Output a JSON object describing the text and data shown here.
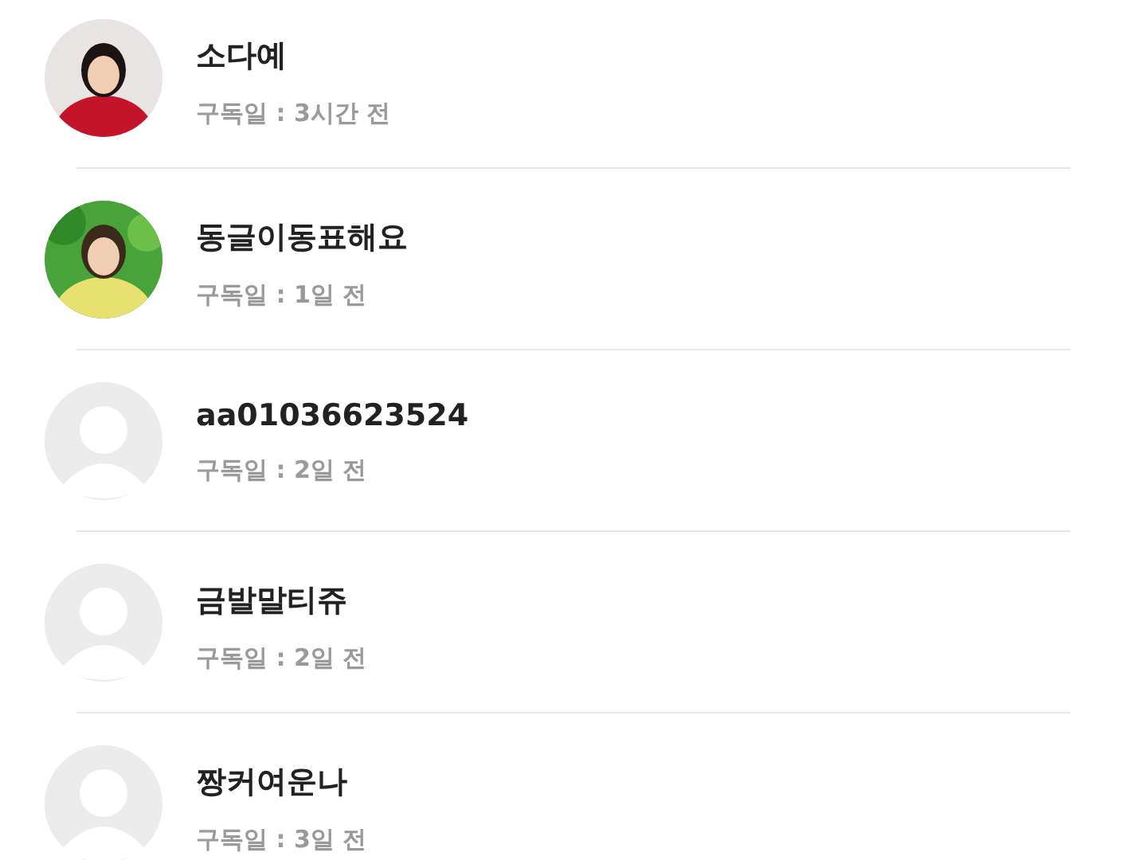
{
  "subscribers": [
    {
      "name": "소다예",
      "subscribed": "구독일 : 3시간 전"
    },
    {
      "name": "동글이동표해요",
      "subscribed": "구독일 : 1일 전"
    },
    {
      "name": "aa01036623524",
      "subscribed": "구독일 : 2일 전",
      "avatar": {
        "kind": "default"
      }
    },
    {
      "name": "금발말티쥬",
      "subscribed": "구독일 : 2일 전",
      "avatar": {
        "kind": "default"
      }
    },
    {
      "name": "짱커여운나",
      "subscribed": "구독일 : 3일 전",
      "avatar": {
        "kind": "default"
      }
    }
  ]
}
